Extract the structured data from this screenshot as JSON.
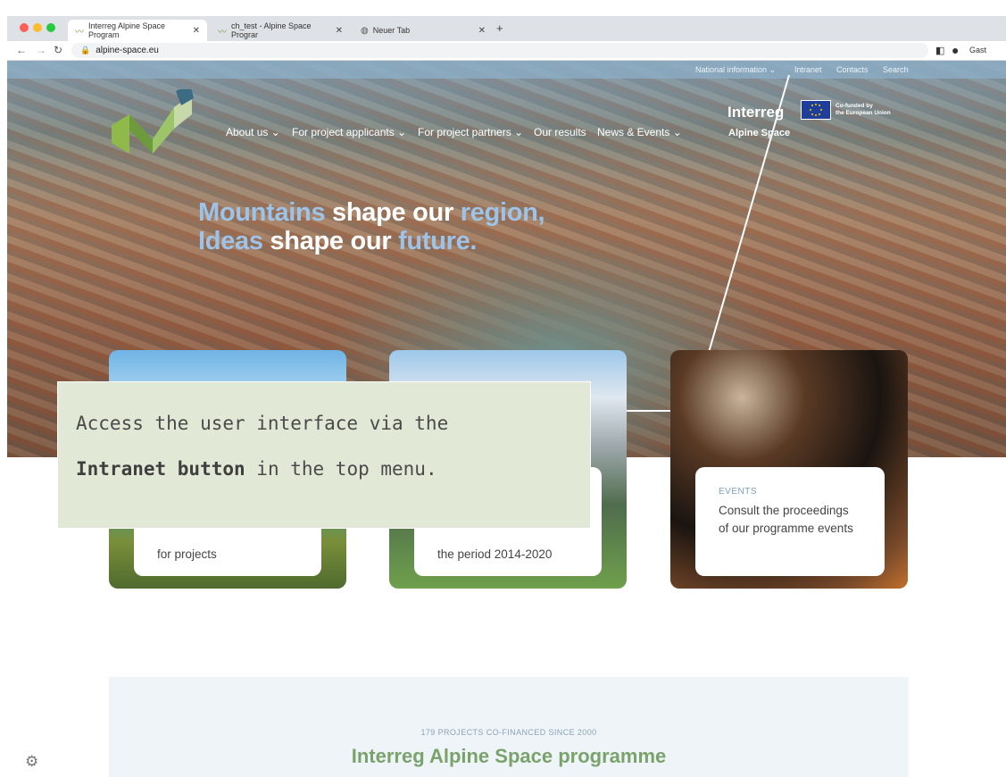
{
  "browser": {
    "tabs": [
      {
        "label": "Interreg Alpine Space Program"
      },
      {
        "label": "ch_test - Alpine Space Prograr"
      },
      {
        "label": "Neuer Tab"
      }
    ],
    "new_tab": "+",
    "url": "alpine-space.eu",
    "profile": "Gast"
  },
  "util_nav": {
    "national": "National information ⌄",
    "intranet": "Intranet",
    "contacts": "Contacts",
    "search": "Search"
  },
  "main_nav": {
    "about": "About us ⌄",
    "applicants": "For project applicants ⌄",
    "partners": "For project partners ⌄",
    "results": "Our results",
    "news": "News & Events ⌄"
  },
  "brand": {
    "interreg": "Interreg",
    "cofunded": [
      "Co-funded by",
      "the European Union"
    ],
    "alpine": "Alpine Space"
  },
  "hero": {
    "line1": {
      "a": "Mountains",
      "b": " shape our ",
      "c": "region,"
    },
    "line2": {
      "a": "Ideas",
      "b": " shape our ",
      "c": "future."
    }
  },
  "cards": [
    {
      "label": "",
      "desc": "for projects"
    },
    {
      "label": "",
      "desc": "the period 2014-2020"
    },
    {
      "label": "EVENTS",
      "desc1": "Consult the proceedings",
      "desc2": "of our programme events"
    }
  ],
  "overlay": {
    "line1": "Access the user interface via the",
    "line2_bold": "Intranet button",
    "line2_rest": " in the top menu."
  },
  "programme": {
    "count": "179 PROJECTS CO-FINANCED SINCE 2000",
    "title": "Interreg Alpine Space programme"
  },
  "colors": {
    "accent_blue": "#9ec3e8",
    "accent_green": "#7aa36c",
    "overlay_bg": "#e1e9d6"
  }
}
